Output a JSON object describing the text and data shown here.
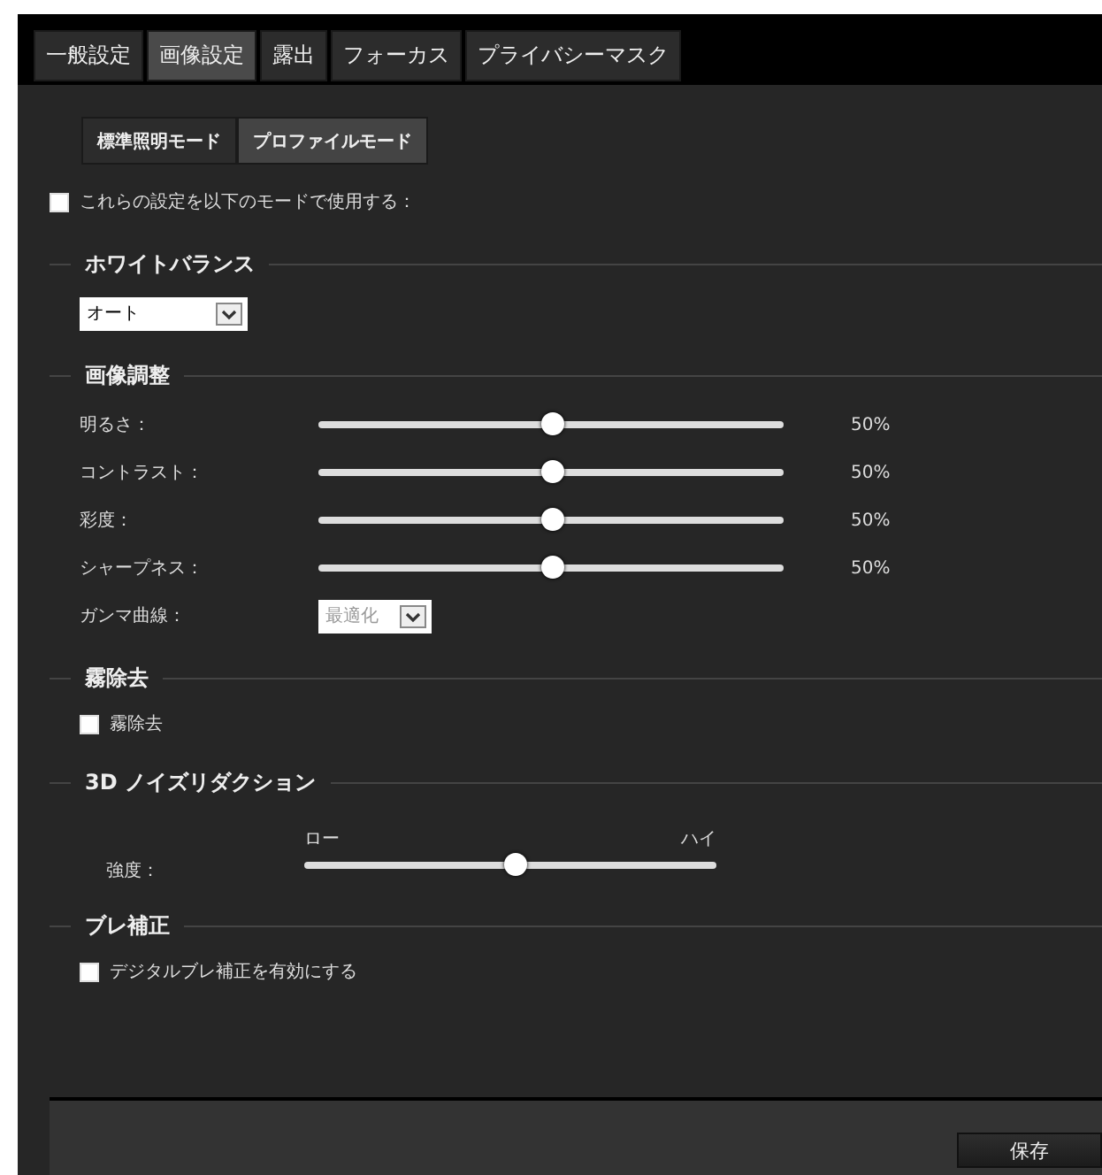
{
  "tabs": [
    {
      "label": "一般設定",
      "selected": false
    },
    {
      "label": "画像設定",
      "selected": true
    },
    {
      "label": "露出",
      "selected": false
    },
    {
      "label": "フォーカス",
      "selected": false
    },
    {
      "label": "プライバシーマスク",
      "selected": false
    }
  ],
  "mode_tabs": [
    {
      "label": "標準照明モード",
      "selected": false
    },
    {
      "label": "プロファイルモード",
      "selected": true
    }
  ],
  "use_for_modes": {
    "label": "これらの設定を以下のモードで使用する：",
    "checked": false
  },
  "sections": [
    {
      "title": "ホワイトバランス",
      "items": [
        {
          "kind": "select",
          "value": "オート",
          "disabled": false
        }
      ]
    },
    {
      "title": "画像調整",
      "items": [
        {
          "kind": "slider",
          "label": "明るさ：",
          "level": 0.5,
          "reading": "50%"
        },
        {
          "kind": "slider",
          "label": "コントラスト：",
          "level": 0.5,
          "reading": "50%"
        },
        {
          "kind": "slider",
          "label": "彩度：",
          "level": 0.5,
          "reading": "50%"
        },
        {
          "kind": "slider",
          "label": "シャープネス：",
          "level": 0.5,
          "reading": "50%"
        },
        {
          "kind": "select",
          "label": "ガンマ曲線：",
          "value": "最適化",
          "disabled": true
        }
      ]
    },
    {
      "title": "霧除去",
      "items": [
        {
          "kind": "checkbox",
          "label": "霧除去",
          "checked": false
        }
      ]
    },
    {
      "title": "3D ノイズリダクション",
      "items": [
        {
          "kind": "scale",
          "label": "強度：",
          "low": "ロー",
          "high": "ハイ",
          "level": 0.51
        }
      ]
    },
    {
      "title": "ブレ補正",
      "items": [
        {
          "kind": "checkbox",
          "label": "デジタルブレ補正を有効にする",
          "checked": false
        }
      ]
    }
  ],
  "save_button": "保存"
}
